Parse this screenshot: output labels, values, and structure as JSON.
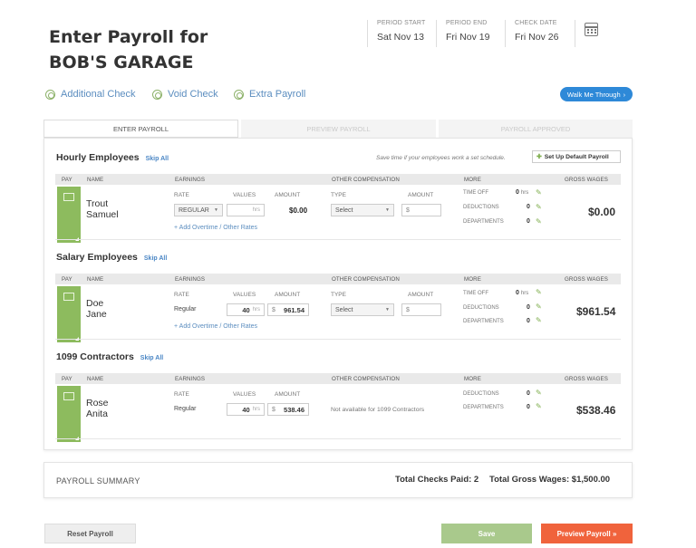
{
  "header": {
    "title_line1": "Enter Payroll for",
    "title_line2": "BOB'S GARAGE",
    "period_start_label": "PERIOD START",
    "period_start": "Sat Nov 13",
    "period_end_label": "PERIOD END",
    "period_end": "Fri Nov 19",
    "check_date_label": "CHECK DATE",
    "check_date": "Fri Nov 26",
    "calendar_icon": "calendar-icon"
  },
  "actions": {
    "additional_check": "Additional Check",
    "void_check": "Void Check",
    "extra_payroll": "Extra Payroll",
    "walk_me_through": "Walk Me Through"
  },
  "steps": [
    "ENTER PAYROLL",
    "PREVIEW PAYROLL",
    "PAYROLL APPROVED"
  ],
  "columns": {
    "pay": "PAY",
    "name": "NAME",
    "earnings": "EARNINGS",
    "other_comp": "OTHER COMPENSATION",
    "more": "MORE",
    "gross": "GROSS WAGES",
    "rate": "RATE",
    "values": "VALUES",
    "amount": "AMOUNT",
    "type": "TYPE",
    "time_off": "TIME OFF",
    "deductions": "DEDUCTIONS",
    "departments": "DEPARTMENTS"
  },
  "hourly": {
    "title": "Hourly Employees",
    "skip": "Skip All",
    "hint": "Save time if your employees work a set schedule.",
    "default_btn": "Set Up Default Payroll",
    "last": "Trout",
    "first": "Samuel",
    "rate": "REGULAR",
    "hrs_placeholder": "hrs",
    "amount": "$0.00",
    "type": "Select",
    "comp_amount": "$",
    "add_link": "+ Add Overtime / Other Rates",
    "time_off": "0",
    "time_off_unit": "hrs",
    "deductions": "0",
    "departments": "0",
    "gross": "$0.00"
  },
  "salary": {
    "title": "Salary Employees",
    "skip": "Skip All",
    "last": "Doe",
    "first": "Jane",
    "rate": "Regular",
    "hours": "40",
    "hrs_unit": "hrs",
    "amount_prefix": "$",
    "amount": "961.54",
    "type": "Select",
    "comp_amount": "$",
    "add_link": "+ Add Overtime / Other Rates",
    "time_off": "0",
    "time_off_unit": "hrs",
    "deductions": "0",
    "departments": "0",
    "gross": "$961.54"
  },
  "contractors": {
    "title": "1099 Contractors",
    "skip": "Skip All",
    "last": "Rose",
    "first": "Anita",
    "rate": "Regular",
    "hours": "40",
    "hrs_unit": "hrs",
    "amount_prefix": "$",
    "amount": "538.46",
    "not_available": "Not available for 1099 Contractors",
    "deductions": "0",
    "departments": "0",
    "gross": "$538.46"
  },
  "summary": {
    "label": "PAYROLL SUMMARY",
    "checks_paid": "Total Checks Paid: 2",
    "gross_wages": "Total Gross Wages: $1,500.00"
  },
  "footer": {
    "reset": "Reset Payroll",
    "save": "Save",
    "preview": "Preview Payroll »"
  },
  "colors": {
    "accent_green": "#8dbb5e",
    "link_blue": "#5b8dbf",
    "walk_blue": "#2e89d8",
    "preview_orange": "#f0633c",
    "save_green": "#a9c98c"
  }
}
